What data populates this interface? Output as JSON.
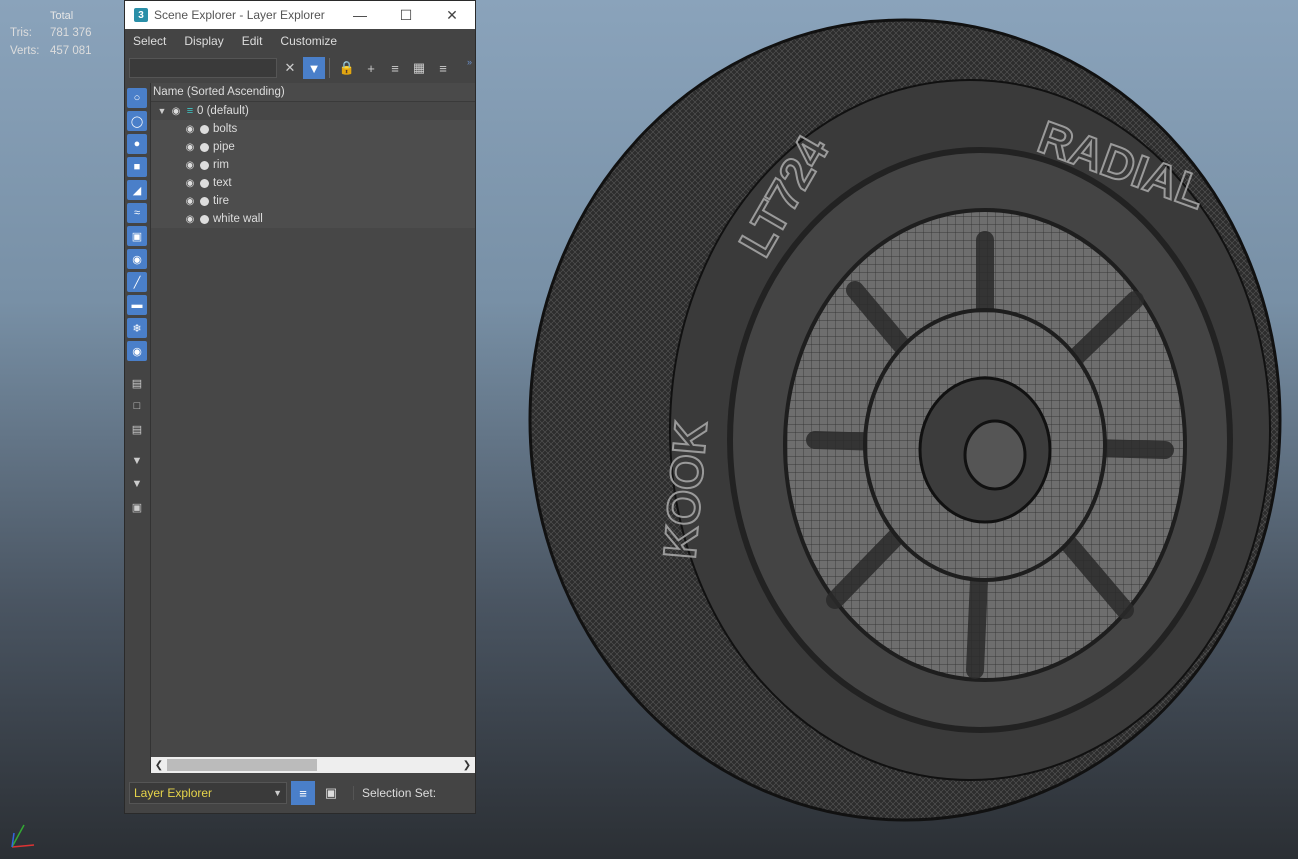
{
  "stats": {
    "header": "Total",
    "rows": [
      {
        "label": "Tris:",
        "value": "781 376"
      },
      {
        "label": "Verts:",
        "value": "457 081"
      }
    ]
  },
  "window": {
    "title": "Scene Explorer - Layer Explorer",
    "app_icon": "3",
    "menu": [
      "Select",
      "Display",
      "Edit",
      "Customize"
    ],
    "search": {
      "value": "",
      "placeholder": ""
    },
    "column_header": "Name (Sorted Ascending)",
    "root_layer": "0 (default)",
    "layers": [
      "bolts",
      "pipe",
      "rim",
      "text",
      "tire",
      "white wall"
    ],
    "explorer_dropdown": "Layer Explorer",
    "selection_set_label": "Selection Set:"
  },
  "colors": {
    "accent": "#4a7fc9",
    "dropdown_text": "#e6d44a"
  }
}
